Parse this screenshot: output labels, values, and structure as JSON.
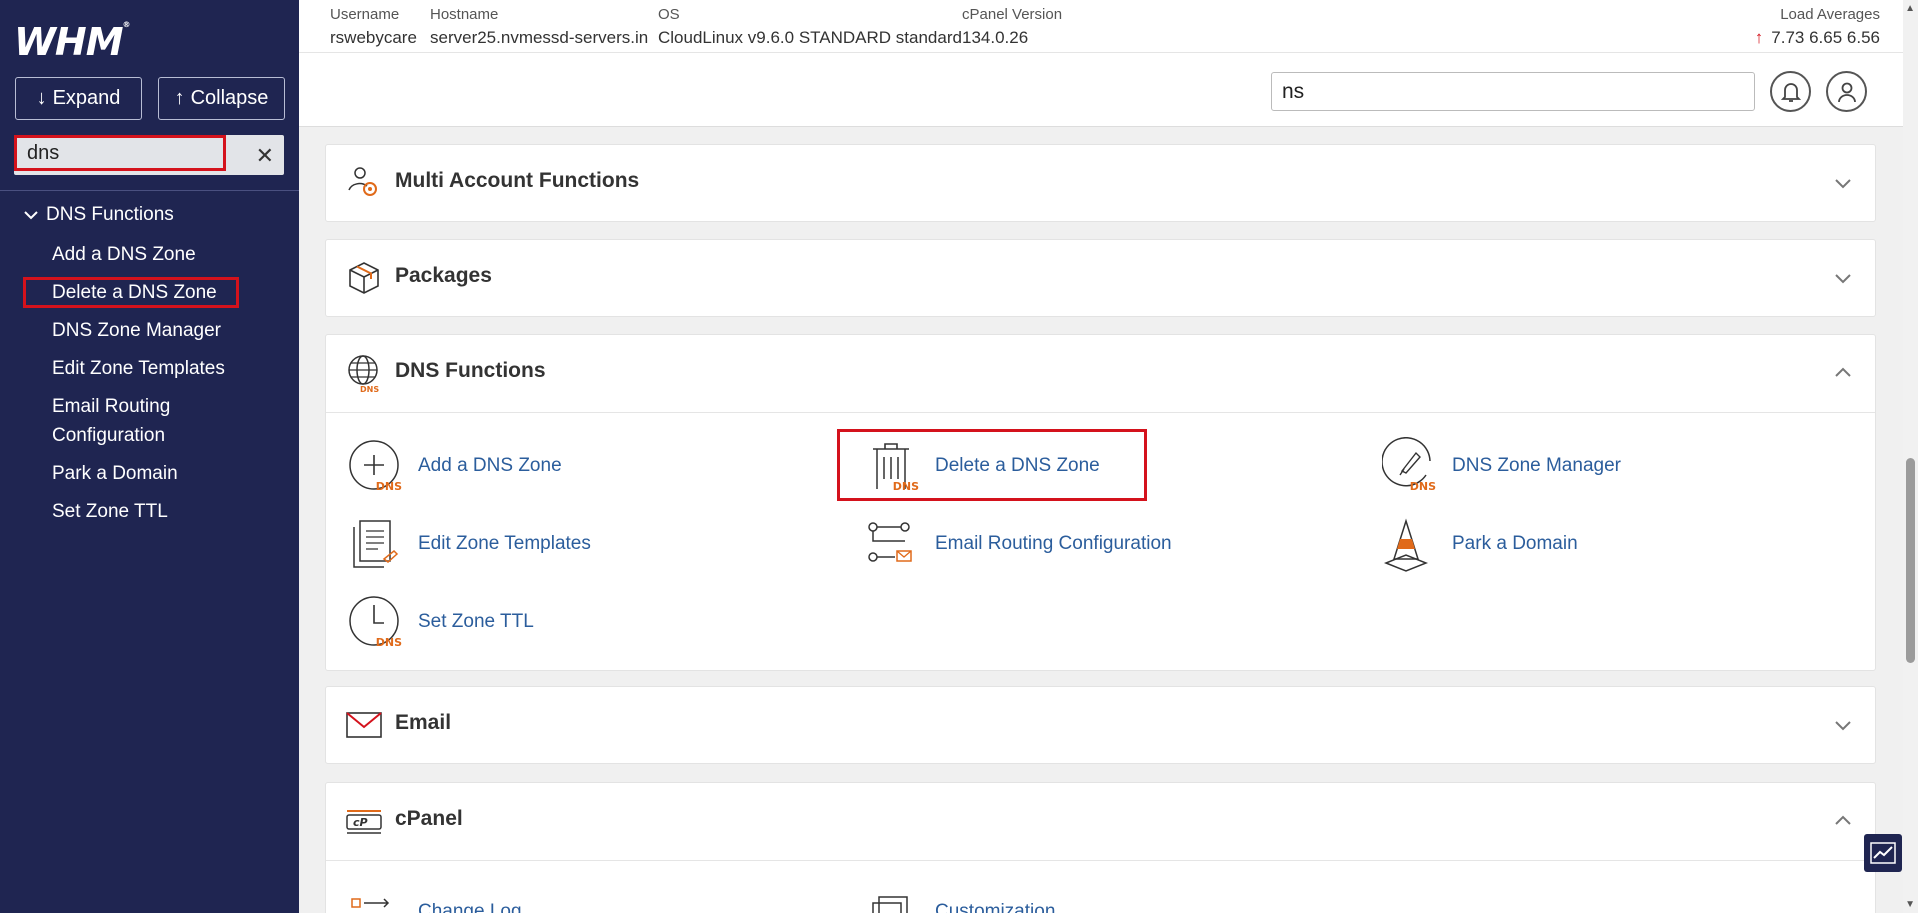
{
  "sidebar": {
    "logo": "WHM",
    "expand_label": "Expand",
    "collapse_label": "Collapse",
    "search_value": "dns",
    "group_label": "DNS Functions",
    "items": [
      {
        "label": "Add a DNS Zone"
      },
      {
        "label": "Delete a DNS Zone"
      },
      {
        "label": "DNS Zone Manager"
      },
      {
        "label": "Edit Zone Templates"
      },
      {
        "label": "Email Routing Configuration"
      },
      {
        "label": "Park a Domain"
      },
      {
        "label": "Set Zone TTL"
      }
    ]
  },
  "header": {
    "username_label": "Username",
    "username": "rswebycare",
    "hostname_label": "Hostname",
    "hostname": "server25.nvmessd-servers.in",
    "os_label": "OS",
    "os": "CloudLinux v9.6.0 STANDARD standard",
    "cpanel_label": "cPanel Version",
    "cpanel": "134.0.26",
    "load_label": "Load Averages",
    "load_values": "7.73  6.65  6.56",
    "search_value": "ns"
  },
  "cards": {
    "multi": "Multi Account Functions",
    "packages": "Packages",
    "dns": "DNS Functions",
    "email": "Email",
    "cpanel": "cPanel"
  },
  "dns_tools": {
    "add": "Add a DNS Zone",
    "delete": "Delete a DNS Zone",
    "zonemgr": "DNS Zone Manager",
    "edit": "Edit Zone Templates",
    "email": "Email Routing Configuration",
    "park": "Park a Domain",
    "ttl": "Set Zone TTL",
    "dns_tag": "DNS"
  },
  "cpanel_tools": {
    "changelog": "Change Log",
    "customization": "Customization"
  },
  "colors": {
    "sidebar_bg": "#1f2551",
    "highlight": "#d4121c",
    "link": "#2b5d9c",
    "accent": "#e06a1a"
  }
}
